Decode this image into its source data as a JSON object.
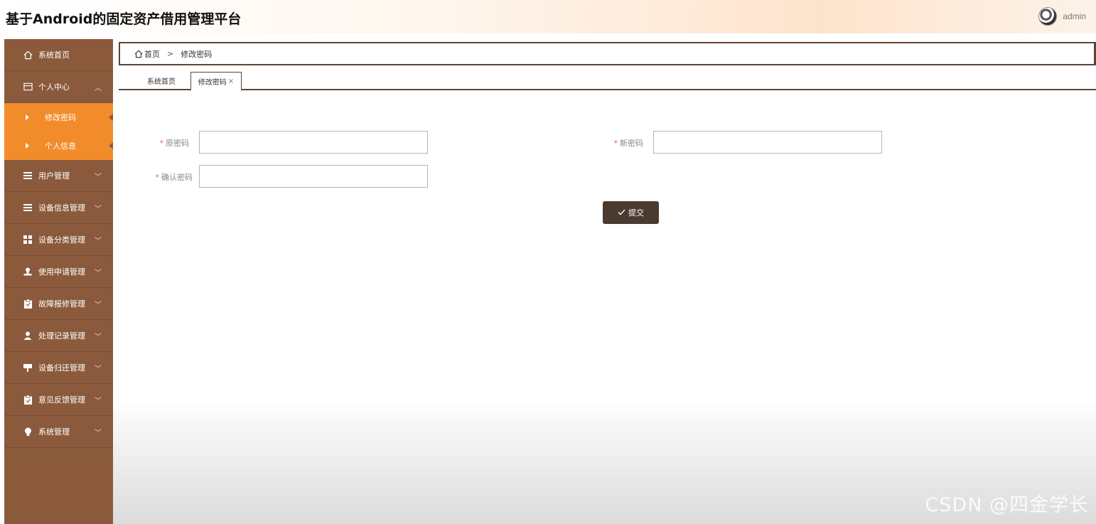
{
  "header": {
    "title": "基于Android的固定资产借用管理平台",
    "user_name": "admin"
  },
  "sidebar": {
    "items": [
      {
        "label": "系统首页",
        "icon": "home-icon"
      },
      {
        "label": "个人中心",
        "icon": "window-icon",
        "expanded": true,
        "children": [
          {
            "label": "修改密码"
          },
          {
            "label": "个人信息"
          }
        ]
      },
      {
        "label": "用户管理",
        "icon": "list-icon"
      },
      {
        "label": "设备信息管理",
        "icon": "list-icon"
      },
      {
        "label": "设备分类管理",
        "icon": "grid-icon"
      },
      {
        "label": "使用申请管理",
        "icon": "stamp-icon"
      },
      {
        "label": "故障报修管理",
        "icon": "clipboard-icon"
      },
      {
        "label": "处理记录管理",
        "icon": "person-icon"
      },
      {
        "label": "设备归还管理",
        "icon": "sign-icon"
      },
      {
        "label": "意见反馈管理",
        "icon": "clipboard-check-icon"
      },
      {
        "label": "系统管理",
        "icon": "bulb-icon"
      }
    ]
  },
  "breadcrumb": {
    "home": "首页",
    "separator": ">",
    "current": "修改密码"
  },
  "tabs": {
    "home": "系统首页",
    "active": "修改密码",
    "close": "×"
  },
  "form": {
    "old_password_label": "原密码",
    "new_password_label": "新密码",
    "confirm_password_label": "确认密码",
    "required_mark": "*",
    "old_password_value": "",
    "new_password_value": "",
    "confirm_password_value": "",
    "submit_label": "提交"
  },
  "watermark": "CSDN @四金学长",
  "colors": {
    "sidebar": "#8b5a3c",
    "sidebar_active": "#f28c2a",
    "button": "#4a3a30",
    "border": "#5a4538"
  }
}
